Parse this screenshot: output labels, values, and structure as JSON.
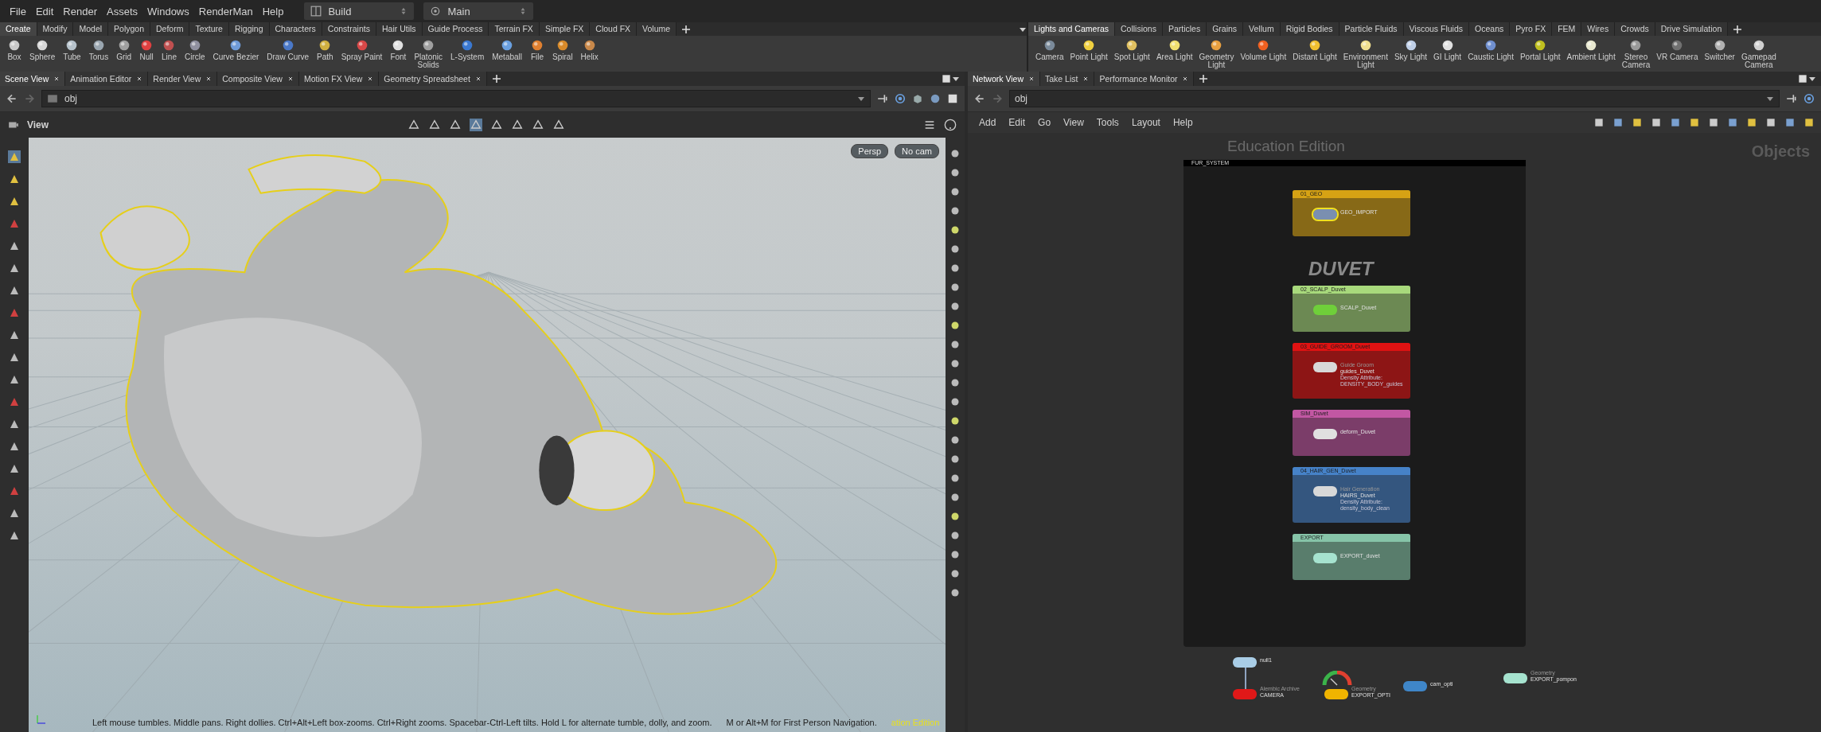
{
  "menubar": {
    "items": [
      "File",
      "Edit",
      "Render",
      "Assets",
      "Windows",
      "RenderMan",
      "Help"
    ],
    "desktop": "Build",
    "context": "Main"
  },
  "shelf_left": {
    "tabs": [
      {
        "label": "Create",
        "selected": true
      },
      {
        "label": "Modify",
        "selected": false
      },
      {
        "label": "Model",
        "selected": false
      },
      {
        "label": "Polygon",
        "selected": false
      },
      {
        "label": "Deform",
        "selected": false
      },
      {
        "label": "Texture",
        "selected": false
      },
      {
        "label": "Rigging",
        "selected": false
      },
      {
        "label": "Characters",
        "selected": false
      },
      {
        "label": "Constraints",
        "selected": false
      },
      {
        "label": "Hair Utils",
        "selected": false
      },
      {
        "label": "Guide Process",
        "selected": false
      },
      {
        "label": "Terrain FX",
        "selected": false
      },
      {
        "label": "Simple FX",
        "selected": false
      },
      {
        "label": "Cloud FX",
        "selected": false
      },
      {
        "label": "Volume",
        "selected": false
      }
    ],
    "tools": [
      "Box",
      "Sphere",
      "Tube",
      "Torus",
      "Grid",
      "Null",
      "Line",
      "Circle",
      "Curve Bezier",
      "Draw Curve",
      "Path",
      "Spray Paint",
      "Font",
      "Platonic\nSolids",
      "L-System",
      "Metaball",
      "File",
      "Spiral",
      "Helix"
    ]
  },
  "shelf_right": {
    "tabs": [
      {
        "label": "Lights and Cameras",
        "selected": true
      },
      {
        "label": "Collisions",
        "selected": false
      },
      {
        "label": "Particles",
        "selected": false
      },
      {
        "label": "Grains",
        "selected": false
      },
      {
        "label": "Vellum",
        "selected": false
      },
      {
        "label": "Rigid Bodies",
        "selected": false
      },
      {
        "label": "Particle Fluids",
        "selected": false
      },
      {
        "label": "Viscous Fluids",
        "selected": false
      },
      {
        "label": "Oceans",
        "selected": false
      },
      {
        "label": "Pyro FX",
        "selected": false
      },
      {
        "label": "FEM",
        "selected": false
      },
      {
        "label": "Wires",
        "selected": false
      },
      {
        "label": "Crowds",
        "selected": false
      },
      {
        "label": "Drive Simulation",
        "selected": false
      }
    ],
    "tools": [
      "Camera",
      "Point Light",
      "Spot Light",
      "Area Light",
      "Geometry\nLight",
      "Volume Light",
      "Distant Light",
      "Environment\nLight",
      "Sky Light",
      "GI Light",
      "Caustic Light",
      "Portal Light",
      "Ambient Light",
      "Stereo\nCamera",
      "VR Camera",
      "Switcher",
      "Gamepad\nCamera"
    ]
  },
  "scene_pane": {
    "tabs": [
      {
        "label": "Scene View",
        "selected": true
      },
      {
        "label": "Animation Editor",
        "selected": false
      },
      {
        "label": "Render View",
        "selected": false
      },
      {
        "label": "Composite View",
        "selected": false
      },
      {
        "label": "Motion FX View",
        "selected": false
      },
      {
        "label": "Geometry Spreadsheet",
        "selected": false
      }
    ],
    "path": "obj",
    "view_title": "View",
    "view_buttons": [
      "Persp",
      "No cam"
    ],
    "hint": "Left mouse tumbles. Middle pans. Right dollies. Ctrl+Alt+Left box-zooms. Ctrl+Right zooms. Spacebar-Ctrl-Left tilts. Hold L for alternate tumble, dolly, and zoom.",
    "hint_2": "M or Alt+M for First Person Navigation.",
    "edition_text": "ation Edition"
  },
  "network_pane": {
    "tabs": [
      {
        "label": "Network View",
        "selected": true
      },
      {
        "label": "Take List",
        "selected": false
      },
      {
        "label": "Performance Monitor",
        "selected": false
      }
    ],
    "path": "obj",
    "menu": [
      "Add",
      "Edit",
      "Go",
      "View",
      "Tools",
      "Layout",
      "Help"
    ],
    "edition_label": "Education Edition",
    "context_label": "Objects",
    "network_box": {
      "title": "FUR_SYSTEM",
      "items": [
        {
          "kind": "subnet",
          "title": "01_GEO",
          "color": "#d6a214",
          "nodes": [
            {
              "name": "GEO_IMPORT",
              "color": "#7a8fb0",
              "selected": true
            }
          ]
        },
        {
          "kind": "sticky",
          "title": "DUVET"
        },
        {
          "kind": "subnet",
          "title": "02_SCALP_Duvet",
          "color": "#a8d97c",
          "nodes": [
            {
              "name": "SCALP_Duvet",
              "color": "#6fcf3a",
              "selected": false
            }
          ]
        },
        {
          "kind": "subnet",
          "title": "03_GUIDE_GROOM_Duvet",
          "color": "#e01212",
          "nodes": [
            {
              "type_label": "Guide Groom",
              "name": "guides_Duvet",
              "lines": [
                "Density Attribute:",
                "DENSITY_BODY_guides"
              ],
              "color": "#d8d8d8",
              "selected": false
            }
          ]
        },
        {
          "kind": "subnet",
          "title": "SIM_Duvet",
          "color": "#c257a3",
          "nodes": [
            {
              "name": "deform_Duvet",
              "color": "#e0e0e0",
              "selected": false
            }
          ]
        },
        {
          "kind": "subnet",
          "title": "04_HAIR_GEN_Duvet",
          "color": "#4682c8",
          "nodes": [
            {
              "type_label": "Hair Generation",
              "name": "HAIRS_Duvet",
              "lines": [
                "Density Attribute:",
                "density_body_clean"
              ],
              "color": "#d8d8d8",
              "selected": false
            }
          ]
        },
        {
          "kind": "subnet",
          "title": "EXPORT",
          "color": "#86c4a8",
          "nodes": [
            {
              "name": "EXPORT_duvet",
              "color": "#a6e3cf",
              "selected": false
            }
          ]
        }
      ]
    },
    "nodes": [
      {
        "name": "null1",
        "color": "#a9cde6",
        "selected": false
      },
      {
        "type_label": "Alembic Archive",
        "name": "CAMERA",
        "color": "#e01818",
        "selected": false
      },
      {
        "type_label": "Geometry",
        "name": "EXPORT_OPTI",
        "color": "#f0b400",
        "selected": false
      },
      {
        "name": "cam_opti",
        "color": "#3f86c8",
        "selected": false
      },
      {
        "type_label": "Geometry",
        "name": "EXPORT_pompon",
        "color": "#a6e3cf",
        "selected": false
      }
    ]
  }
}
